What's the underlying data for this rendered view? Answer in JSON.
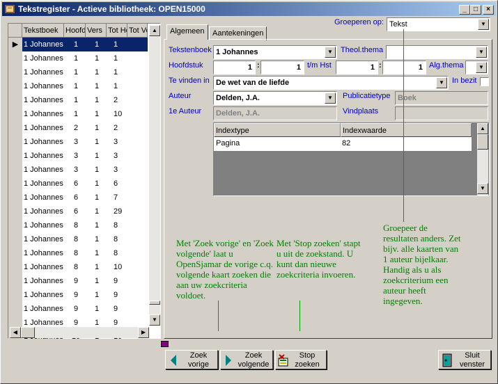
{
  "window": {
    "title": "Tekstregister - Actieve bibliotheek: OPEN15000"
  },
  "grid": {
    "columns": [
      "Tekstboek",
      "Hoofd",
      "Vers",
      "Tot Ho",
      "Tot Ve"
    ],
    "rows": [
      [
        "1 Johannes 1",
        "1",
        "1",
        "1"
      ],
      [
        "1 Johannes 1",
        "1",
        "1",
        "1"
      ],
      [
        "1 Johannes 1",
        "1",
        "1",
        "1"
      ],
      [
        "1 Johannes 1",
        "1",
        "1",
        "1"
      ],
      [
        "1 Johannes 1",
        "1",
        "1",
        "2"
      ],
      [
        "1 Johannes 1",
        "1",
        "1",
        "10"
      ],
      [
        "1 Johannes 1",
        "2",
        "1",
        "2"
      ],
      [
        "1 Johannes 1",
        "3",
        "1",
        "3"
      ],
      [
        "1 Johannes 1",
        "3",
        "1",
        "3"
      ],
      [
        "1 Johannes 1",
        "3",
        "1",
        "3"
      ],
      [
        "1 Johannes 1",
        "6",
        "1",
        "6"
      ],
      [
        "1 Johannes 1",
        "6",
        "1",
        "7"
      ],
      [
        "1 Johannes 1",
        "6",
        "1",
        "29"
      ],
      [
        "1 Johannes 1",
        "8",
        "1",
        "8"
      ],
      [
        "1 Johannes 1",
        "8",
        "1",
        "8"
      ],
      [
        "1 Johannes 1",
        "8",
        "1",
        "8"
      ],
      [
        "1 Johannes 1",
        "8",
        "1",
        "10"
      ],
      [
        "1 Johannes 1",
        "9",
        "1",
        "9"
      ],
      [
        "1 Johannes 1",
        "9",
        "1",
        "9"
      ],
      [
        "1 Johannes 1",
        "9",
        "1",
        "9"
      ],
      [
        "1 Johannes 1",
        "9",
        "1",
        "9"
      ],
      [
        "1 Johannes 1",
        "10",
        "1",
        "10"
      ]
    ]
  },
  "groeperen": {
    "label": "Groeperen op:",
    "value": "Tekst"
  },
  "tabs": {
    "algemeen": "Algemeen",
    "aantekeningen": "Aantekeningen"
  },
  "form": {
    "tekstenboek_label": "Tekstenboek",
    "tekstenboek_value": "1 Johannes",
    "theol_label": "Theol.thema",
    "theol_value": "",
    "hoofdstuk_label": "Hoofdstuk",
    "hoofdstuk_value": "1",
    "vers_value": "1",
    "tmhst_label": "t/m Hst",
    "tmhst_value": "1",
    "tmvers_value": "1",
    "alg_label": "Alg.thema",
    "alg_value": "",
    "tevinden_label": "Te vinden in",
    "tevinden_value": "De wet van de liefde",
    "inbezit_label": "In bezit",
    "auteur_label": "Auteur",
    "auteur_value": "Delden, J.A.",
    "publicatie_label": "Publicatietype",
    "publicatie_value": "Boek",
    "eersteauteur_label": "1e Auteur",
    "eersteauteur_value": "Delden, J.A.",
    "vindplaats_label": "Vindplaats",
    "vindplaats_value": ""
  },
  "index_table": {
    "headers": [
      "Indextype",
      "Indexwaarde"
    ],
    "rows": [
      [
        "Pagina",
        "82"
      ]
    ]
  },
  "notes": {
    "zoek": "Met 'Zoek vorige' en 'Zoek volgende' laat u OpenSjamar de vorige c.q. volgende kaart zoeken die aan uw zoekcriteria voldoet.",
    "stop": "Met 'Stop zoeken' stapt u uit de zoekstand. U kunt dan nieuwe zoekcriteria invoeren.",
    "groepeer": "Groepeer de resultaten anders. Zet bijv. alle kaarten van 1 auteur bijelkaar. Handig als u als zoekcriterium een auteur heeft ingegeven."
  },
  "buttons": {
    "zoek_vorige_1": "Zoek",
    "zoek_vorige_2": "vorige",
    "zoek_volgende_1": "Zoek",
    "zoek_volgende_2": "volgende",
    "stop_zoeken_1": "Stop",
    "stop_zoeken_2": "zoeken",
    "sluit_venster_1": "Sluit",
    "sluit_venster_2": "venster"
  },
  "colors": {
    "title_start": "#0a246a",
    "label_blue": "#0000c0",
    "note_green": "#008000"
  }
}
